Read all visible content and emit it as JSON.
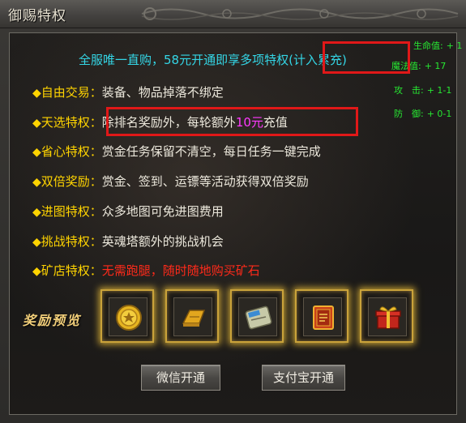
{
  "window": {
    "title": "御赐特权"
  },
  "headline": "全服唯一直购，58元开通即享多项特权(计入累充)",
  "privileges": [
    {
      "label": "自由交易：",
      "desc": "装备、物品掉落不绑定"
    },
    {
      "label": "天选特权：",
      "desc_pre": "除排名奖励外，每轮额外",
      "desc_hl": "10元",
      "desc_post": "充值"
    },
    {
      "label": "省心特权：",
      "desc": "赏金任务保留不清空，每日任务一键完成"
    },
    {
      "label": "双倍奖励：",
      "desc": "赏金、签到、运镖等活动获得双倍奖励"
    },
    {
      "label": "进图特权：",
      "desc": "众多地图可免进图费用"
    },
    {
      "label": "挑战特权：",
      "desc": "英魂塔额外的挑战机会"
    },
    {
      "label": "矿店特权：",
      "desc": "无需跑腿，随时随地购买矿石"
    }
  ],
  "side_stats": [
    {
      "label": "生命值:",
      "value": "+ 1"
    },
    {
      "label": "魔法值:",
      "value": "+ 17"
    },
    {
      "label": "攻　击:",
      "value": "+ 1-1"
    },
    {
      "label": "防　御:",
      "value": "+ 0-1"
    }
  ],
  "rewards": {
    "label": "奖励预览",
    "items": [
      "gold-coin-icon",
      "gold-bar-icon",
      "exp-scroll-icon",
      "red-scroll-icon",
      "gift-box-icon"
    ]
  },
  "buttons": {
    "wechat": "微信开通",
    "alipay": "支付宝开通"
  },
  "colors": {
    "label": "#ffd400",
    "headline": "#34d6e6",
    "highlight": "#ff39ff",
    "warning": "#ff2a1a",
    "stat": "#27e832"
  }
}
